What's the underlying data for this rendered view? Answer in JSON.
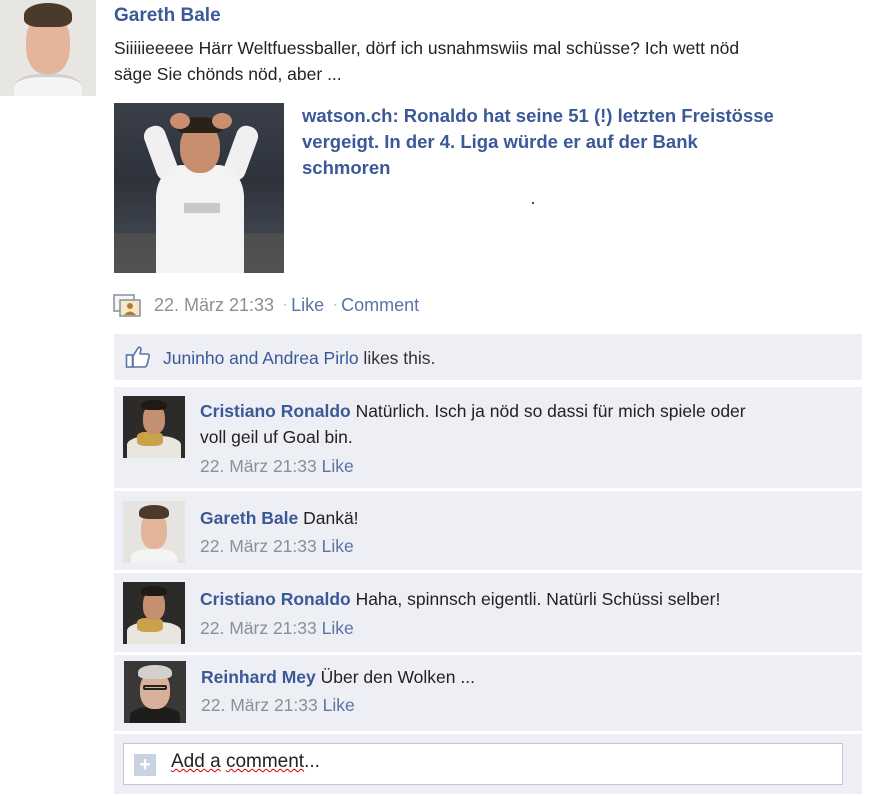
{
  "post": {
    "author": "Gareth Bale",
    "text": "Siiiiieeeee Härr Weltfuessballer, dörf ich usnahmswiis mal schüsse? Ich wett nöd säge Sie chönds nöd, aber ...",
    "text_line1": "Siiiiieeeee Härr Weltfuessballer, dörf ich usnahmswiis mal schüsse? Ich wett nöd",
    "text_line2": "säge Sie chönds nöd, aber ...",
    "share": {
      "title_line1": "watson.ch: Ronaldo hat seine 51 (!) letzten Freistösse",
      "title_line2": "vergeigt. In der 4. Liga würde er auf der Bank",
      "title_line3": "schmoren"
    },
    "timestamp": "22. März 21:33",
    "like_label": "Like",
    "comment_label": "Comment"
  },
  "likes": {
    "names": "Juninho and Andrea Pirlo",
    "suffix": " likes this."
  },
  "comments": [
    {
      "author": "Cristiano Ronaldo",
      "text_line1": " Natürlich. Isch ja nöd so dassi für mich spiele oder",
      "text_line2": "voll geil uf Goal bin.",
      "timestamp": "22. März 21:33",
      "like_label": "Like"
    },
    {
      "author": "Gareth Bale",
      "text_line1": " Dankä!",
      "timestamp": "22. März 21:33",
      "like_label": "Like"
    },
    {
      "author": "Cristiano Ronaldo",
      "text_line1": " Haha, spinnsch eigentli. Natürli Schüssi selber!",
      "timestamp": "22. März 21:33",
      "like_label": "Like"
    },
    {
      "author": "Reinhard Mey",
      "text_line1": " Über den Wolken ...",
      "timestamp": "22. März 21:33",
      "like_label": "Like"
    }
  ],
  "add_comment": {
    "placeholder_a": "Add a",
    "placeholder_b": "comment",
    "placeholder_c": "..."
  },
  "colors": {
    "link_blue": "#3b5998",
    "ufi_background": "#edeff4",
    "meta_gray": "#8a8f98"
  }
}
